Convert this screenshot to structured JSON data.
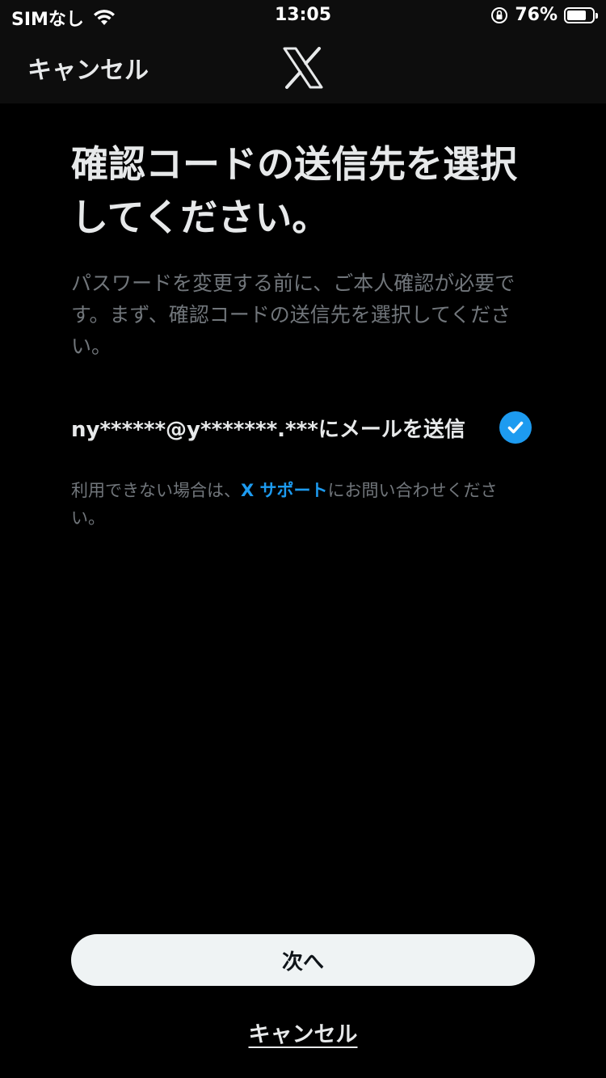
{
  "status_bar": {
    "carrier": "SIMなし",
    "time": "13:05",
    "battery_percent": "76%",
    "battery_level": 0.76,
    "icons": [
      "wifi-icon",
      "orientation-lock-icon",
      "battery-icon"
    ]
  },
  "nav": {
    "cancel_label": "キャンセル",
    "logo": "x-logo-icon"
  },
  "heading": "確認コードの送信先を選択してください。",
  "description": "パスワードを変更する前に、ご本人確認が必要です。まず、確認コードの送信先を選択してください。",
  "option": {
    "label": "ny******@y*******.***にメールを送信",
    "selected": true,
    "icon": "checkmark-icon"
  },
  "support": {
    "prefix": "利用できない場合は、",
    "link": "X サポート",
    "suffix": "にお問い合わせください。"
  },
  "buttons": {
    "next_label": "次へ",
    "cancel_label": "キャンセル"
  },
  "colors": {
    "accent": "#1d9bf0",
    "background": "#000000",
    "topbar": "#0d0d0d",
    "muted_text": "#71767b",
    "primary_text": "#e7e9ea",
    "button_bg": "#eff3f4"
  }
}
